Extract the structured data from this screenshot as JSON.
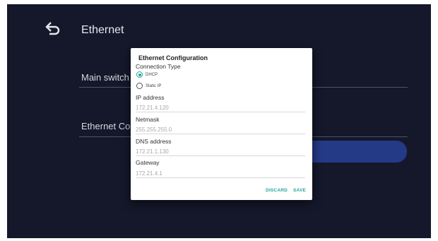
{
  "page": {
    "title": "Ethernet",
    "back_icon": "back-arrow-icon"
  },
  "settings": {
    "main_switch_label": "Main switch",
    "ethernet_config_label": "Ethernet Configuration"
  },
  "dialog": {
    "title": "Ethernet Configuration",
    "connection_type_label": "Connection Type",
    "options": [
      {
        "label": "DHCP",
        "checked": true
      },
      {
        "label": "Static IP",
        "checked": false
      }
    ],
    "fields": {
      "ip_label": "IP address",
      "ip_value": "172.21.4.120",
      "netmask_label": "Netmask",
      "netmask_value": "255.255.255.0",
      "dns_label": "DNS address",
      "dns_value": "172.21.1.130",
      "gateway_label": "Gateway",
      "gateway_value": "172.21.4.1"
    },
    "discard_label": "DISCARD",
    "save_label": "SAVE"
  },
  "colors": {
    "background": "#15182b",
    "accent": "#26a69a",
    "highlight": "#243a86"
  }
}
